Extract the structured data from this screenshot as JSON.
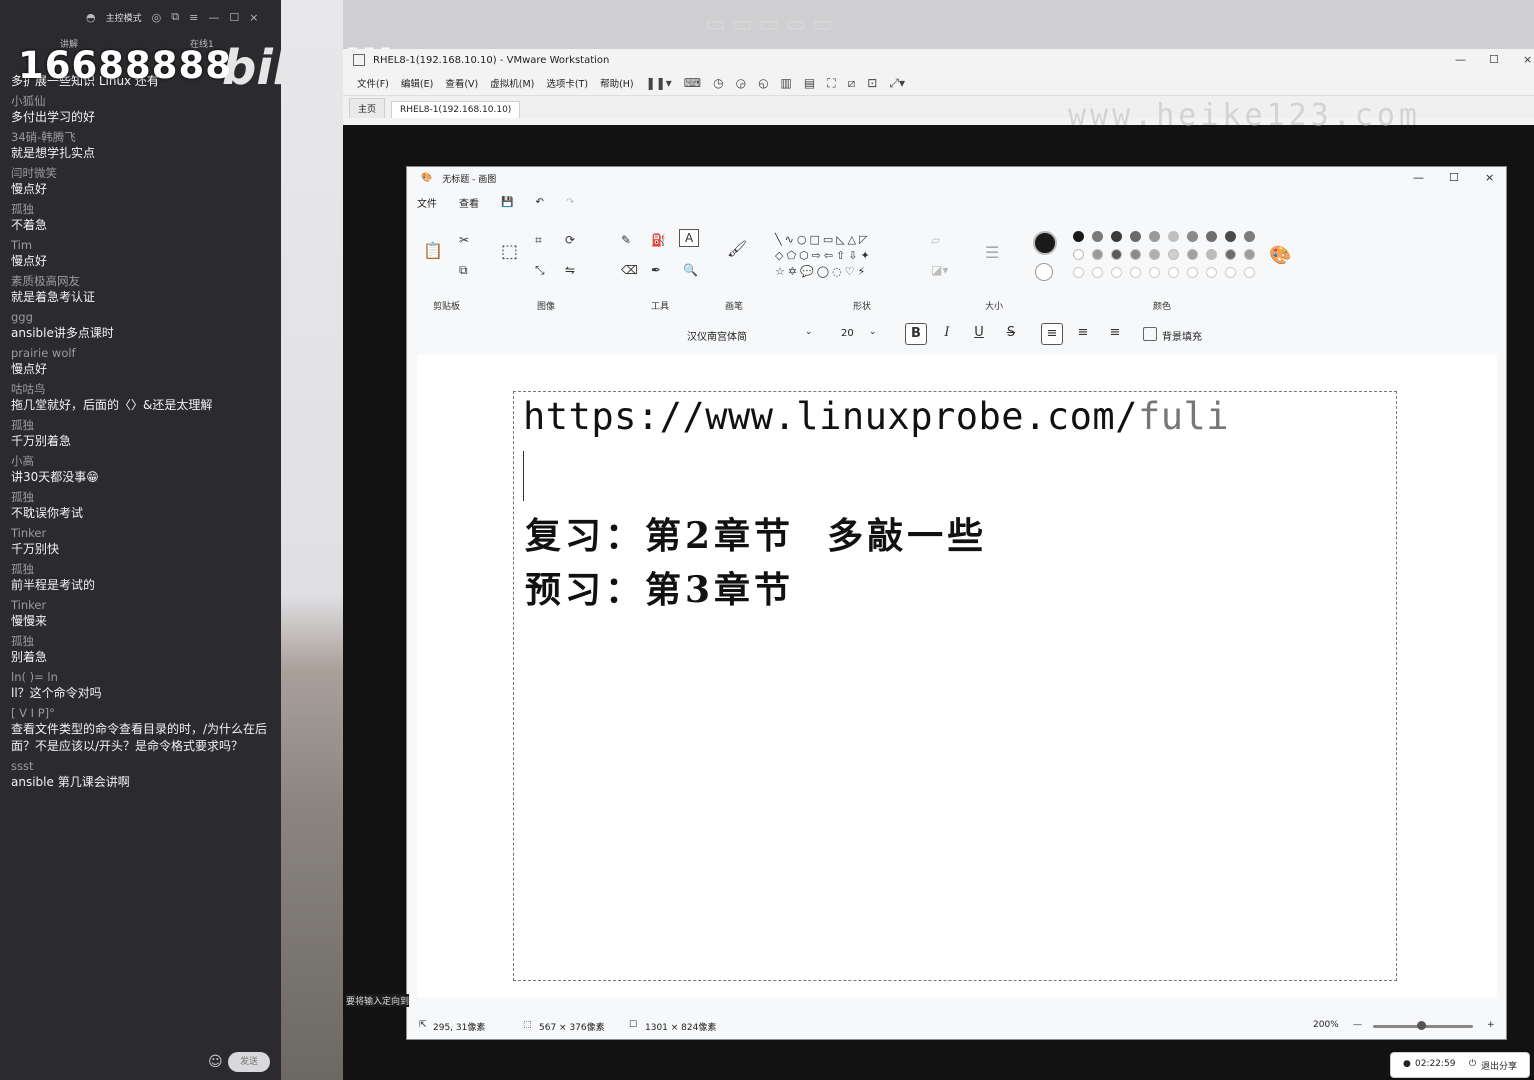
{
  "chat": {
    "header": {
      "mode_label": "主控模式",
      "tab_chat": "讲解",
      "online": "在线1"
    },
    "overlay_number": "16688888",
    "overlay_logo": "bilibili",
    "messages": [
      {
        "name": "",
        "text": "多扩展一些知识 Linux 还有"
      },
      {
        "name": "小狐仙",
        "text": "多付出学习的好"
      },
      {
        "name": "34硝-韩腾飞",
        "text": "就是想学扎实点"
      },
      {
        "name": "闫时微笑",
        "text": "慢点好"
      },
      {
        "name": "孤独",
        "text": "不着急"
      },
      {
        "name": "Tim",
        "text": "慢点好"
      },
      {
        "name": "素质极高网友",
        "text": "就是着急考认证"
      },
      {
        "name": "ggg",
        "text": "ansible讲多点课时"
      },
      {
        "name": "prairie wolf",
        "text": "慢点好"
      },
      {
        "name": "咕咕鸟",
        "text": "拖几堂就好，后面的〈〉&还是太理解"
      },
      {
        "name": "孤独",
        "text": "千万别着急"
      },
      {
        "name": "小高",
        "text": "讲30天都没事😁"
      },
      {
        "name": "孤独",
        "text": "不耽误你考试"
      },
      {
        "name": "Tinker",
        "text": "千万别快"
      },
      {
        "name": "孤独",
        "text": "前半程是考试的"
      },
      {
        "name": "Tinker",
        "text": "慢慢来"
      },
      {
        "name": "孤独",
        "text": "别着急"
      },
      {
        "name": "ln(    )=      ln",
        "text": "ll？这个命令对吗"
      },
      {
        "name": "[      V      I        P]°",
        "text": "查看文件类型的命令查看目录的时，/为什么在后面？不是应该以/开头？是命令格式要求吗？"
      },
      {
        "name": "ssst",
        "text": "ansible 第几课会讲啊"
      }
    ],
    "send_label": "发送"
  },
  "vmware": {
    "title": "RHEL8-1(192.168.10.10) - VMware Workstation",
    "menu": [
      "文件(F)",
      "编辑(E)",
      "查看(V)",
      "虚拟机(M)",
      "选项卡(T)",
      "帮助(H)"
    ],
    "tabs": [
      "主页",
      "RHEL8-1(192.168.10.10)"
    ],
    "watermark": "www.heike123.com",
    "hint": "要将输入定向到"
  },
  "paint": {
    "title": "无标题 - 画图",
    "menu": [
      "文件",
      "查看"
    ],
    "groups": [
      "剪贴板",
      "图像",
      "工具",
      "画笔",
      "形状",
      "大小",
      "颜色"
    ],
    "font_name": "汉仪南宫体简",
    "font_size": "20",
    "fill_label": "背景填充",
    "canvas_url_main": "https://www.linuxprobe.com/",
    "canvas_url_tail": "fuli",
    "canvas_line1": "复习：第2章节  多敲一些",
    "canvas_line2": "预习：第3章节",
    "status_pos": "295, 31像素",
    "status_sel": "567 × 376像素",
    "status_size": "1301 × 824像素",
    "zoom": "200%",
    "palette": [
      "#1a1a1a",
      "#7a7a7a",
      "#3a3a3a",
      "#6a6a6a",
      "#9a9a9a",
      "#c0c0c0",
      "#8a8a8a",
      "#6e6e6e",
      "#4a4a4a",
      "#7c7c7c"
    ],
    "palette2": [
      "#ffffff",
      "#9a9a9a",
      "#5a5a5a",
      "#8a8a8a",
      "#b0b0b0",
      "#d0d0d0",
      "#a0a0a0",
      "#bcbcbc",
      "#6a6a6a",
      "#9c9c9c"
    ]
  },
  "share": {
    "time": "02:22:59",
    "exit_label": "退出分享"
  }
}
